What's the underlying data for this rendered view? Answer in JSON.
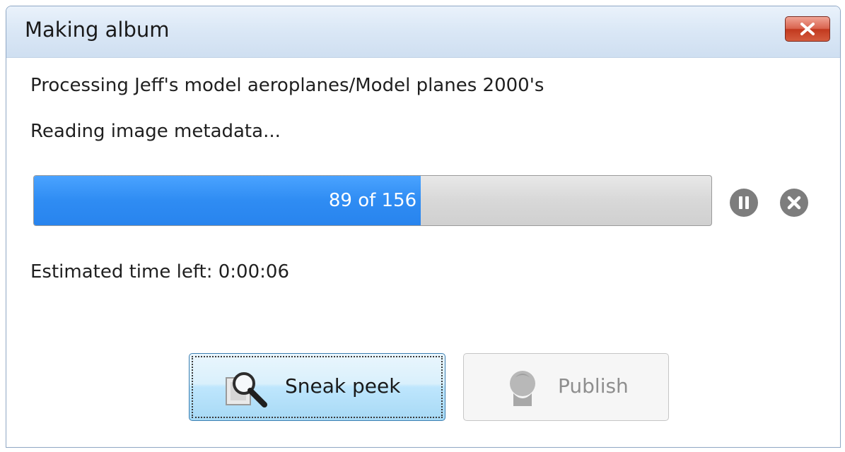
{
  "window": {
    "title": "Making album",
    "close_icon": "close-icon"
  },
  "status": {
    "processing": "Processing Jeff's model aeroplanes/Model planes 2000's",
    "step": "Reading image metadata...",
    "estimate": "Estimated time left: 0:00:06"
  },
  "progress": {
    "label": "89 of 156",
    "current": 89,
    "total": 156,
    "fill_color": "#2f8cf3"
  },
  "controls": {
    "pause_icon": "pause-icon",
    "cancel_icon": "cancel-icon"
  },
  "buttons": {
    "sneak_peek": {
      "label": "Sneak peek",
      "icon": "magnifier-icon"
    },
    "publish": {
      "label": "Publish",
      "icon": "person-icon",
      "disabled": true
    }
  }
}
